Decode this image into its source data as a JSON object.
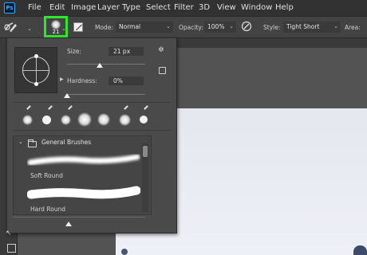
{
  "app": {
    "logo": "Ps"
  },
  "menu": {
    "items": [
      "File",
      "Edit",
      "Image",
      "Layer",
      "Type",
      "Select",
      "Filter",
      "3D",
      "View",
      "Window",
      "Help"
    ]
  },
  "options_bar": {
    "brush_size_badge": "21",
    "mode_label": "Mode:",
    "mode_value": "Normal",
    "opacity_label": "Opacity:",
    "opacity_value": "100%",
    "style_label": "Style:",
    "style_value": "Tight Short",
    "area_label": "Area:",
    "tool_icon": "history-brush-icon",
    "highlight_color": "#2ee82e"
  },
  "brush_panel": {
    "size_label": "Size:",
    "size_value": "21 px",
    "hardness_label": "Hardness:",
    "hardness_value": "0%",
    "size_fraction": 0.42,
    "hardness_fraction": 0.0,
    "recent_brushes": [
      "soft",
      "hard",
      "soft",
      "soft",
      "soft",
      "soft",
      "hard"
    ],
    "group_name": "General Brushes",
    "presets": [
      "Soft Round",
      "Hard Round"
    ]
  }
}
